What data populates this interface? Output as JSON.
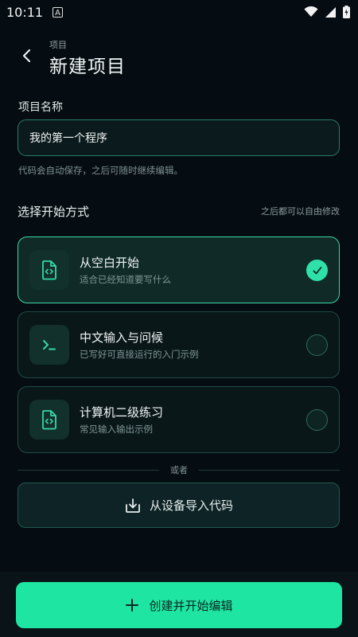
{
  "status_bar": {
    "time": "10:11",
    "notification_icon": "A"
  },
  "header": {
    "subtitle": "项目",
    "title": "新建项目"
  },
  "project_name": {
    "label": "项目名称",
    "value": "我的第一个程序",
    "hint": "代码会自动保存，之后可随时继续编辑。"
  },
  "start_mode": {
    "title": "选择开始方式",
    "note": "之后都可以自由修改",
    "options": [
      {
        "title": "从空白开始",
        "desc": "适合已经知道要写什么",
        "icon": "code-file-icon",
        "selected": true
      },
      {
        "title": "中文输入与问候",
        "desc": "已写好可直接运行的入门示例",
        "icon": "terminal-icon",
        "selected": false
      },
      {
        "title": "计算机二级练习",
        "desc": "常见输入输出示例",
        "icon": "code-file-icon",
        "selected": false
      }
    ]
  },
  "divider": {
    "text": "或者"
  },
  "import_button": {
    "label": "从设备导入代码",
    "icon": "download-tray-icon"
  },
  "primary_button": {
    "label": "创建并开始编辑",
    "icon": "plus-icon"
  },
  "colors": {
    "accent": "#1ee6a2",
    "background": "#060d12",
    "card_border": "#1e4b44",
    "selected_border": "#3fd6a5"
  }
}
